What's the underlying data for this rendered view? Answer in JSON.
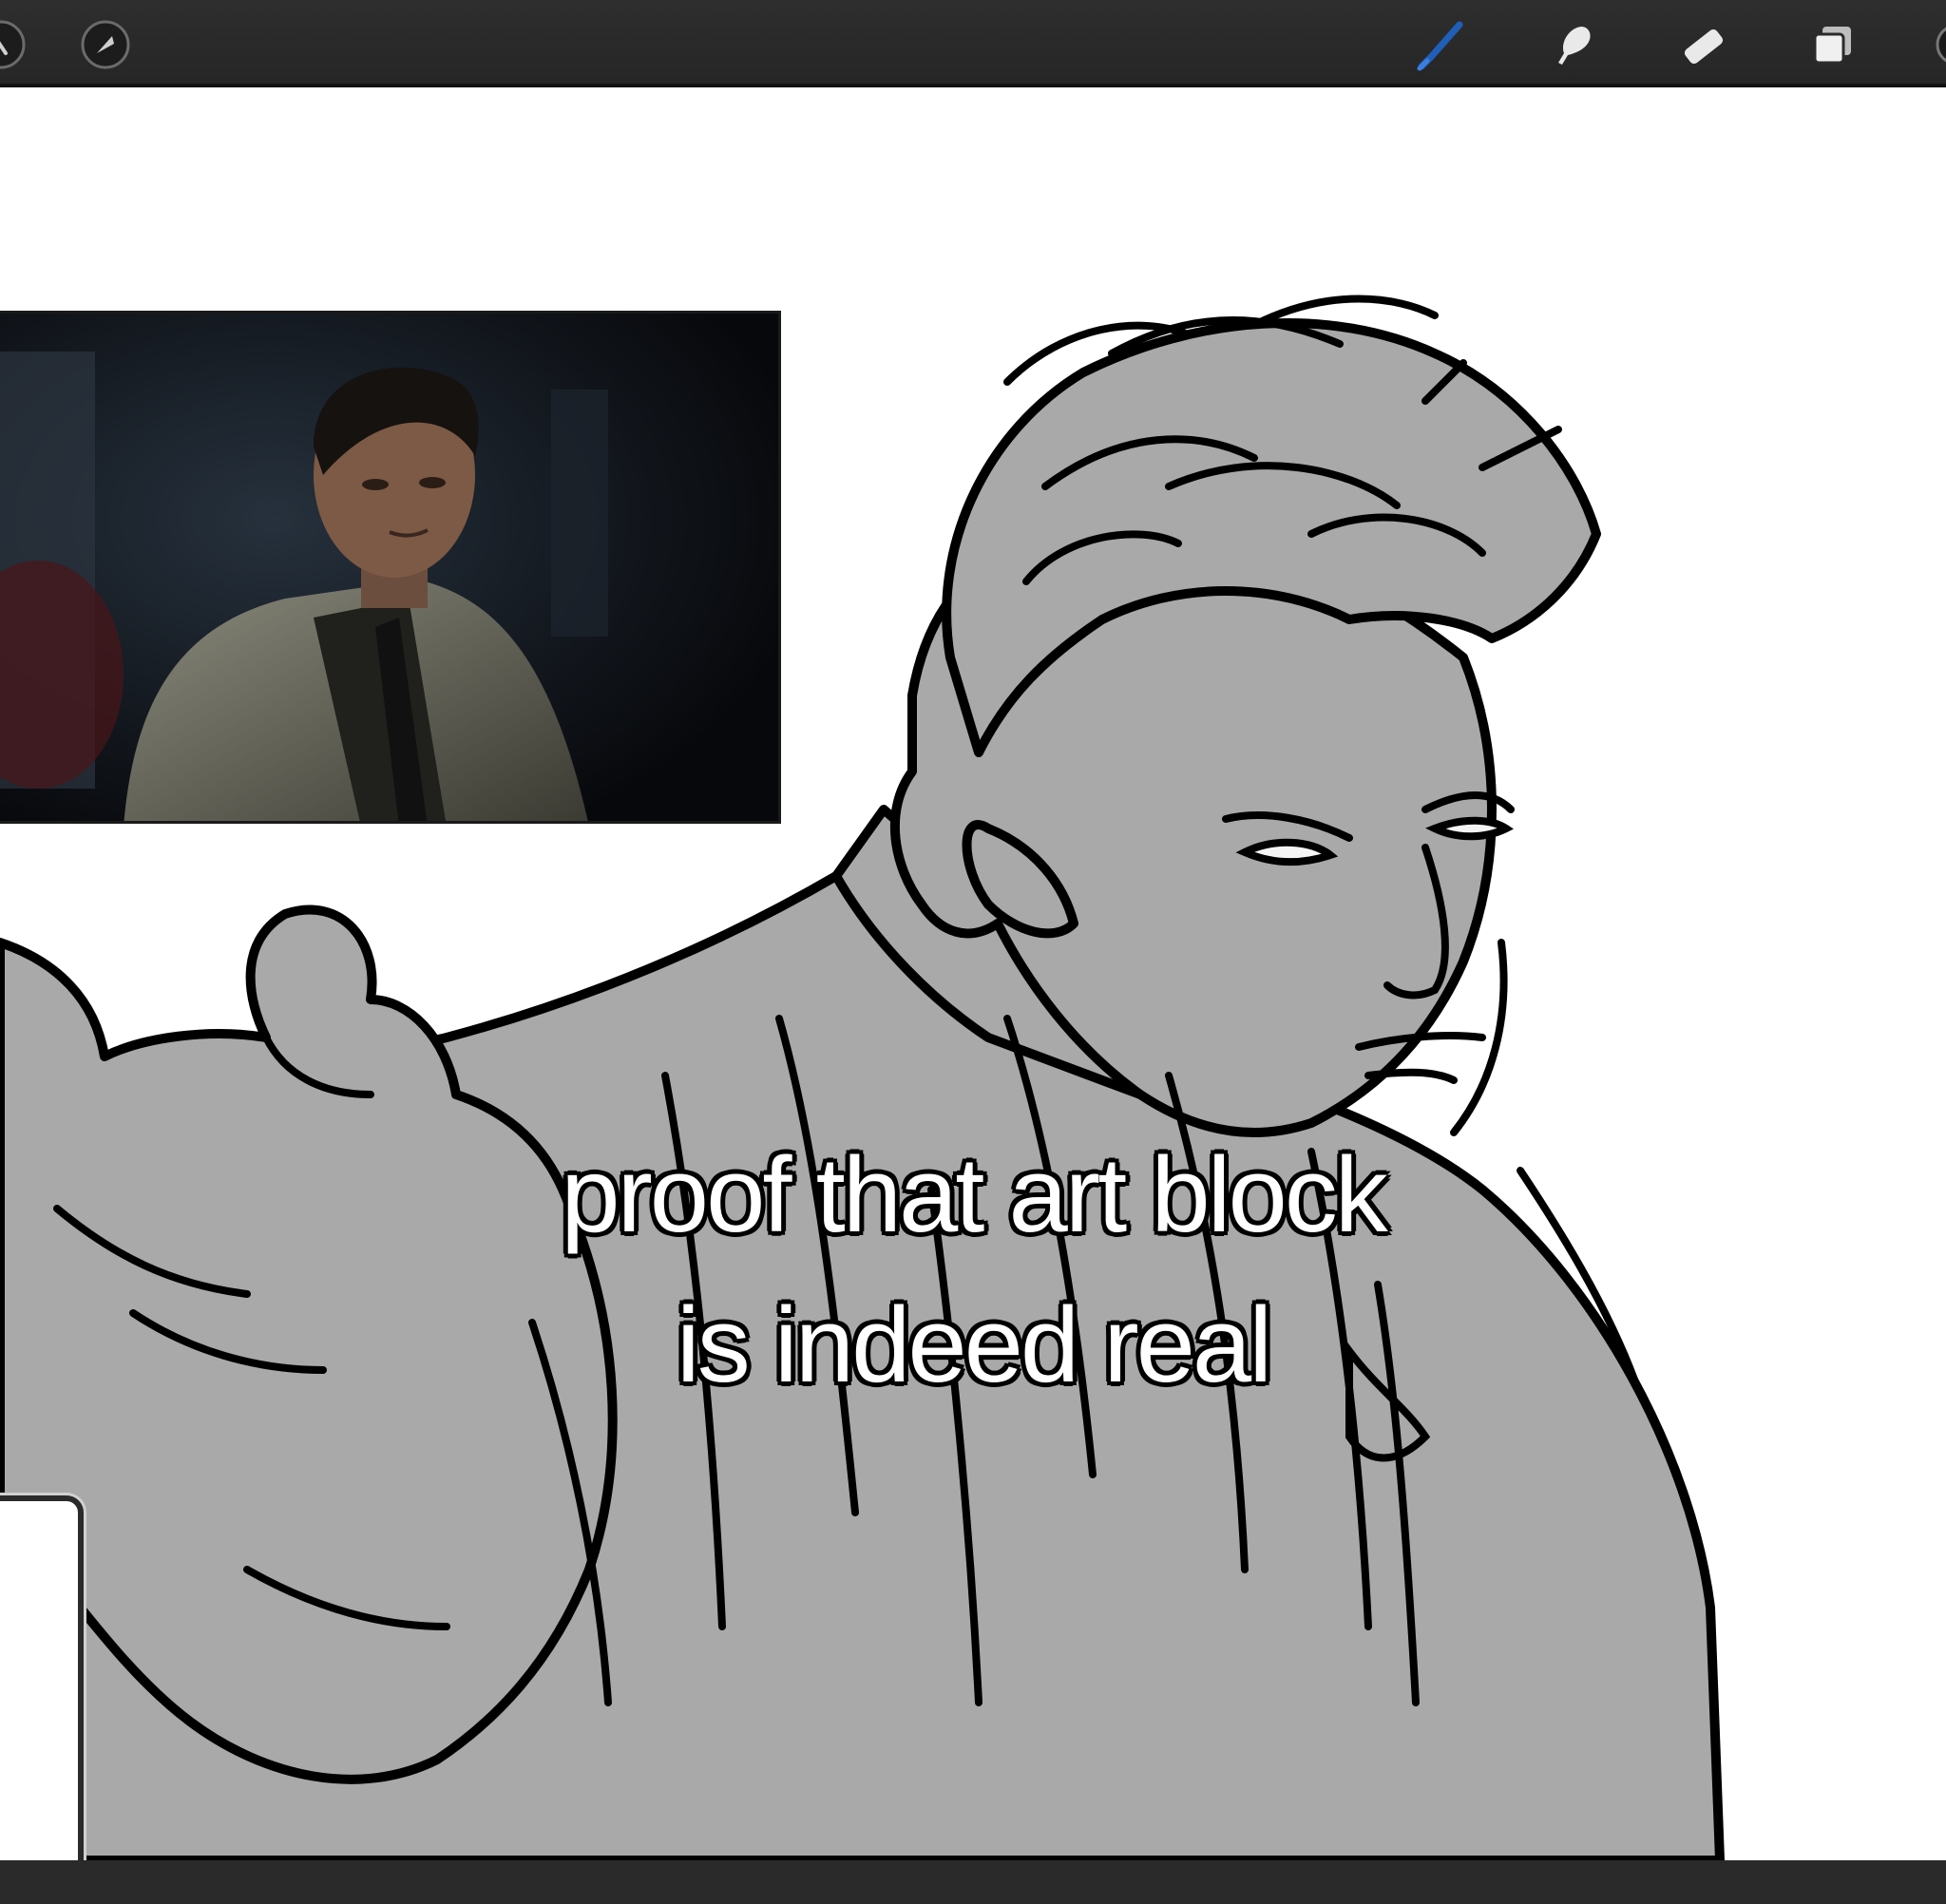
{
  "toolbar": {
    "left_icons": [
      "modify-icon",
      "selection-icon"
    ],
    "right_icons": [
      "brush-icon",
      "smudge-icon",
      "eraser-icon",
      "layers-icon"
    ],
    "active_tool": "brush-icon",
    "active_color": "#1f5fb8"
  },
  "caption": {
    "line1": "proof that art block",
    "line2": "is indeed real"
  },
  "colors": {
    "toolbar_bg": "#2b2b2b",
    "sketch_fill": "#a9a9a9",
    "line_color": "#000000"
  }
}
